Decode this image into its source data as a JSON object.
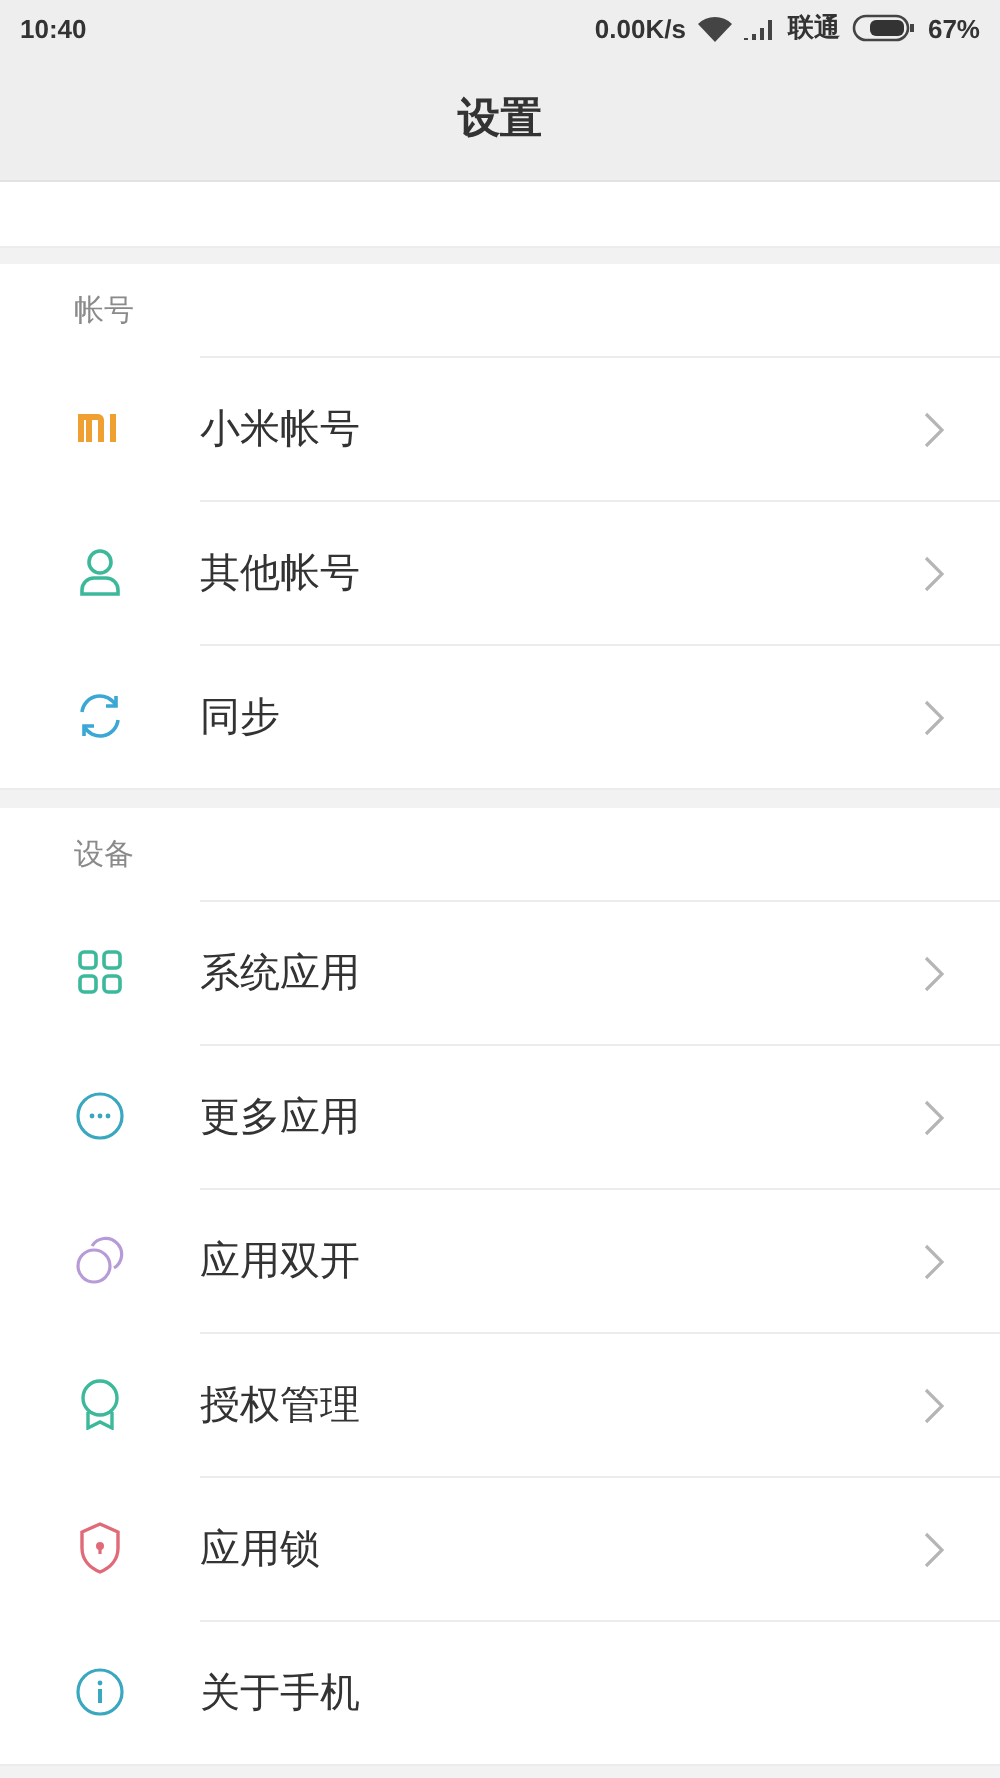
{
  "status_bar": {
    "time": "10:40",
    "speed": "0.00K/s",
    "carrier": "联通",
    "battery": "67%"
  },
  "header": {
    "title": "设置"
  },
  "sections": [
    {
      "label": "帐号",
      "rows": [
        {
          "label": "小米帐号",
          "chevron": true
        },
        {
          "label": "其他帐号",
          "chevron": true
        },
        {
          "label": "同步",
          "chevron": true
        }
      ]
    },
    {
      "label": "设备",
      "rows": [
        {
          "label": "系统应用",
          "chevron": true
        },
        {
          "label": "更多应用",
          "chevron": true
        },
        {
          "label": "应用双开",
          "chevron": true
        },
        {
          "label": "授权管理",
          "chevron": true
        },
        {
          "label": "应用锁",
          "chevron": true
        },
        {
          "label": "关于手机",
          "chevron": false
        }
      ]
    }
  ]
}
